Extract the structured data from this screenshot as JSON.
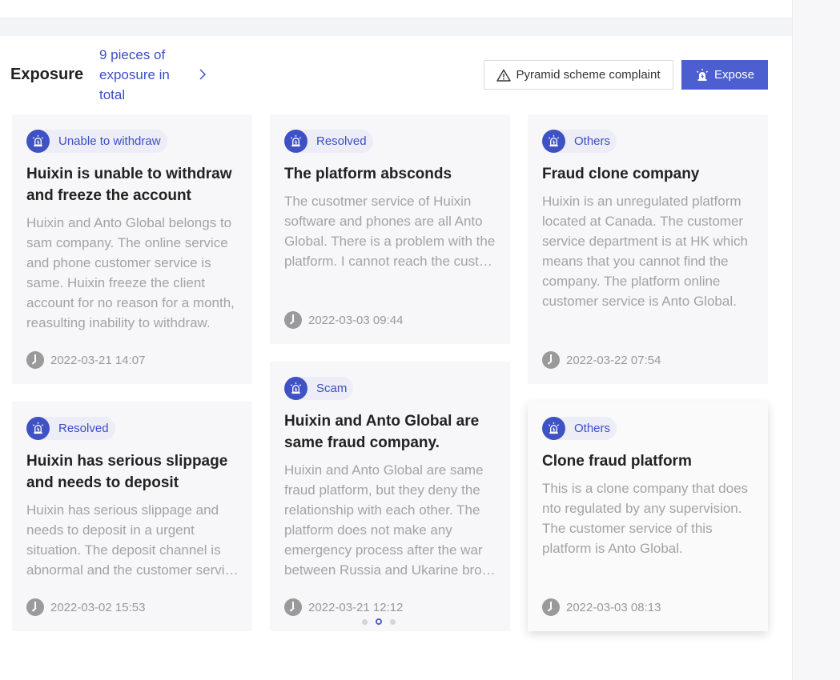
{
  "header": {
    "title": "Exposure",
    "count_text": "9 pieces of exposure in total",
    "pyramid_button": "Pyramid scheme complaint",
    "expose_button": "Expose"
  },
  "colors": {
    "accent": "#4d5fd0",
    "tag_text": "#3c4fc5",
    "tag_bg": "#ecedf6"
  },
  "cards": [
    {
      "tag": "Unable to withdraw",
      "title": "Huixin is unable to withdraw and freeze the account",
      "description": "Huixin and Anto Global belongs to sam company. The online service and phone customer service is same. Huixin freeze the client account for no reason for a month, reasulting inability to withdraw.",
      "time": "2022-03-21 14:07"
    },
    {
      "tag": "Resolved",
      "title": "The platform absconds",
      "description": "The cusotmer service of Huixin software and phones are all Anto Global. There is a problem with the platform. I cannot reach the customer service.",
      "time": "2022-03-03 09:44"
    },
    {
      "tag": "Others",
      "title": "Fraud clone company",
      "description": "Huixin is an unregulated platform located at Canada. The customer service department is at HK which means that you cannot find the company. The platform online customer service is Anto Global.",
      "time": "2022-03-22 07:54"
    },
    {
      "tag": "Resolved",
      "title": "Huixin has serious slippage and needs to deposit",
      "description": "Huixin has serious slippage and needs to deposit in a urgent situation. The deposit channel is abnormal and the customer service cannot be reached.",
      "time": "2022-03-02 15:53"
    },
    {
      "tag": "Scam",
      "title": "Huixin and Anto Global are same fraud company.",
      "description": "Huixin and Anto Global are same fraud platform, but they deny the relationship with each other. The platform does not make any emergency process after the war between Russia and Ukarine broke out.",
      "time": "2022-03-21 12:12"
    },
    {
      "tag": "Others",
      "title": "Clone fraud platform",
      "description": "This is a clone company that does nto regulated by any supervision. The customer service of this platform is Anto Global.",
      "time": "2022-03-03 08:13"
    }
  ]
}
